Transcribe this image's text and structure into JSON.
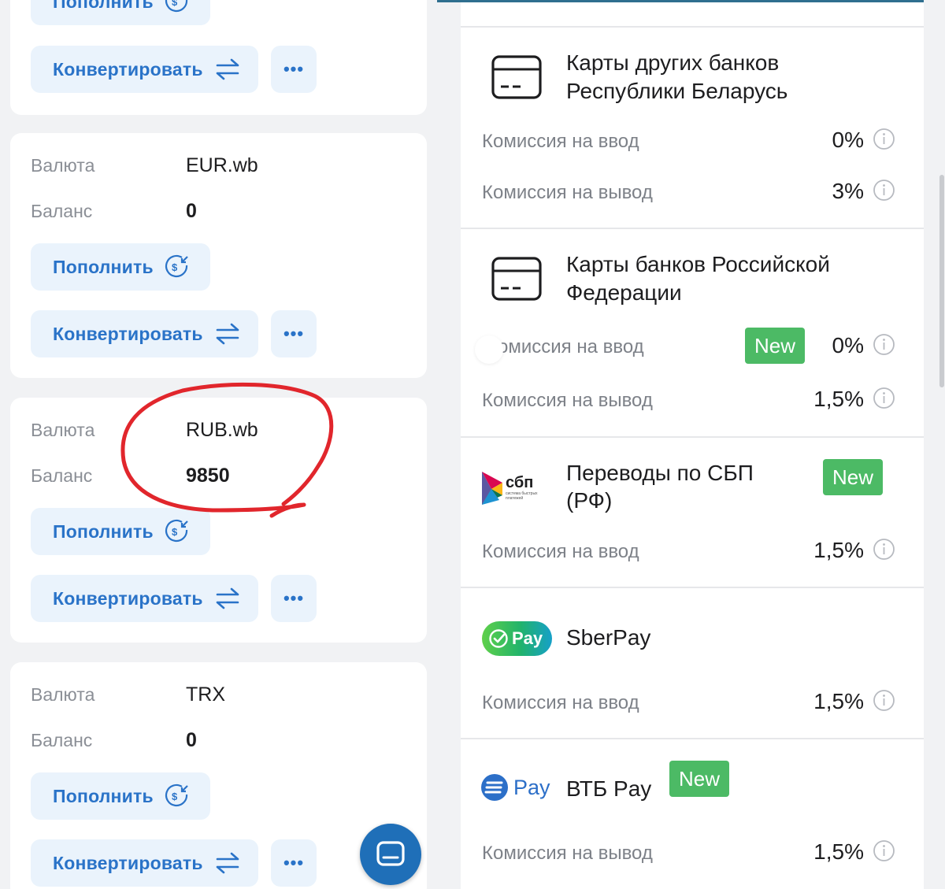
{
  "wallet": {
    "top_card": {
      "topup_label": "Пополнить",
      "convert_label": "Конвертировать",
      "more_label": "•••"
    },
    "cards": [
      {
        "currency_label": "Валюта",
        "currency": "EUR.wb",
        "balance_label": "Баланс",
        "balance": "0",
        "topup_label": "Пополнить",
        "convert_label": "Конвертировать",
        "more_label": "•••"
      },
      {
        "currency_label": "Валюта",
        "currency": "RUB.wb",
        "balance_label": "Баланс",
        "balance": "9850",
        "topup_label": "Пополнить",
        "convert_label": "Конвертировать",
        "more_label": "•••"
      },
      {
        "currency_label": "Валюта",
        "currency": "TRX",
        "balance_label": "Баланс",
        "balance": "0",
        "topup_label": "Пополнить",
        "convert_label": "Конвертировать",
        "more_label": "•••"
      }
    ]
  },
  "methods": [
    {
      "icon": "card-icon",
      "title_line1": "Карты других банков",
      "title_line2": "Республики Беларусь",
      "fees": [
        {
          "label": "Комиссия на ввод",
          "value": "0%"
        },
        {
          "label": "Комиссия на вывод",
          "value": "3%"
        }
      ]
    },
    {
      "icon": "card-icon",
      "title_line1": "Карты банков Российской",
      "title_line2": "Федерации",
      "badge": "New",
      "fees": [
        {
          "label": "омиссия на ввод",
          "value": "0%"
        },
        {
          "label": "Комиссия на вывод",
          "value": "1,5%"
        }
      ]
    },
    {
      "icon": "sbp-logo",
      "logo_text": "сбп",
      "logo_subtext_1": "система быстрых",
      "logo_subtext_2": "платежей",
      "title_line1": "Переводы по СБП",
      "title_line2": "(РФ)",
      "badge": "New",
      "fees": [
        {
          "label": "Комиссия на ввод",
          "value": "1,5%"
        }
      ]
    },
    {
      "icon": "sberpay-logo",
      "logo_text": "Pay",
      "title_line1": "SberPay",
      "fees": [
        {
          "label": "Комиссия на ввод",
          "value": "1,5%"
        }
      ]
    },
    {
      "icon": "vtbpay-logo",
      "logo_text": "Pay",
      "title_line1": "ВТБ Pay",
      "badge": "New",
      "fees": [
        {
          "label": "Комиссия на вывод",
          "value": "1,5%"
        }
      ]
    }
  ],
  "colors": {
    "accent": "#2a73c8",
    "button_bg": "#eaf3fc",
    "badge_new": "#4cba65",
    "annotation_red": "#e1262c",
    "fab": "#1f6fb8"
  }
}
